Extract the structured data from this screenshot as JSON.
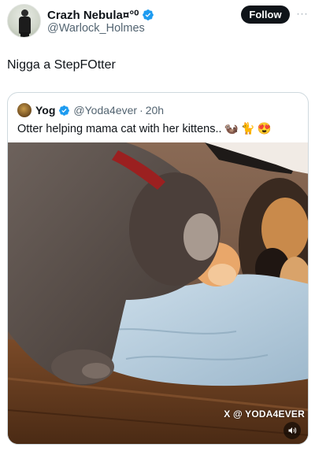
{
  "tweet": {
    "author": {
      "display_name": "Crazh Nebula¤°⁰",
      "handle": "@Warlock_Holmes",
      "verified": true
    },
    "follow_label": "Follow",
    "more_label": "···",
    "text": "Nigga a StepFOtter"
  },
  "quote": {
    "author": {
      "display_name": "Yog",
      "handle": "@Yoda4ever",
      "verified": true
    },
    "separator": "·",
    "time": "20h",
    "text": "Otter helping mama cat with her kittens..",
    "emojis": [
      "🦦",
      "🐈",
      "😍"
    ],
    "media": {
      "watermark": "X @ YODA4EVER",
      "sound_icon": "speaker-icon"
    }
  },
  "colors": {
    "verified": "#1d9bf0",
    "follow_bg": "#0f1419",
    "secondary_text": "#536471",
    "border": "#cfd9de"
  }
}
